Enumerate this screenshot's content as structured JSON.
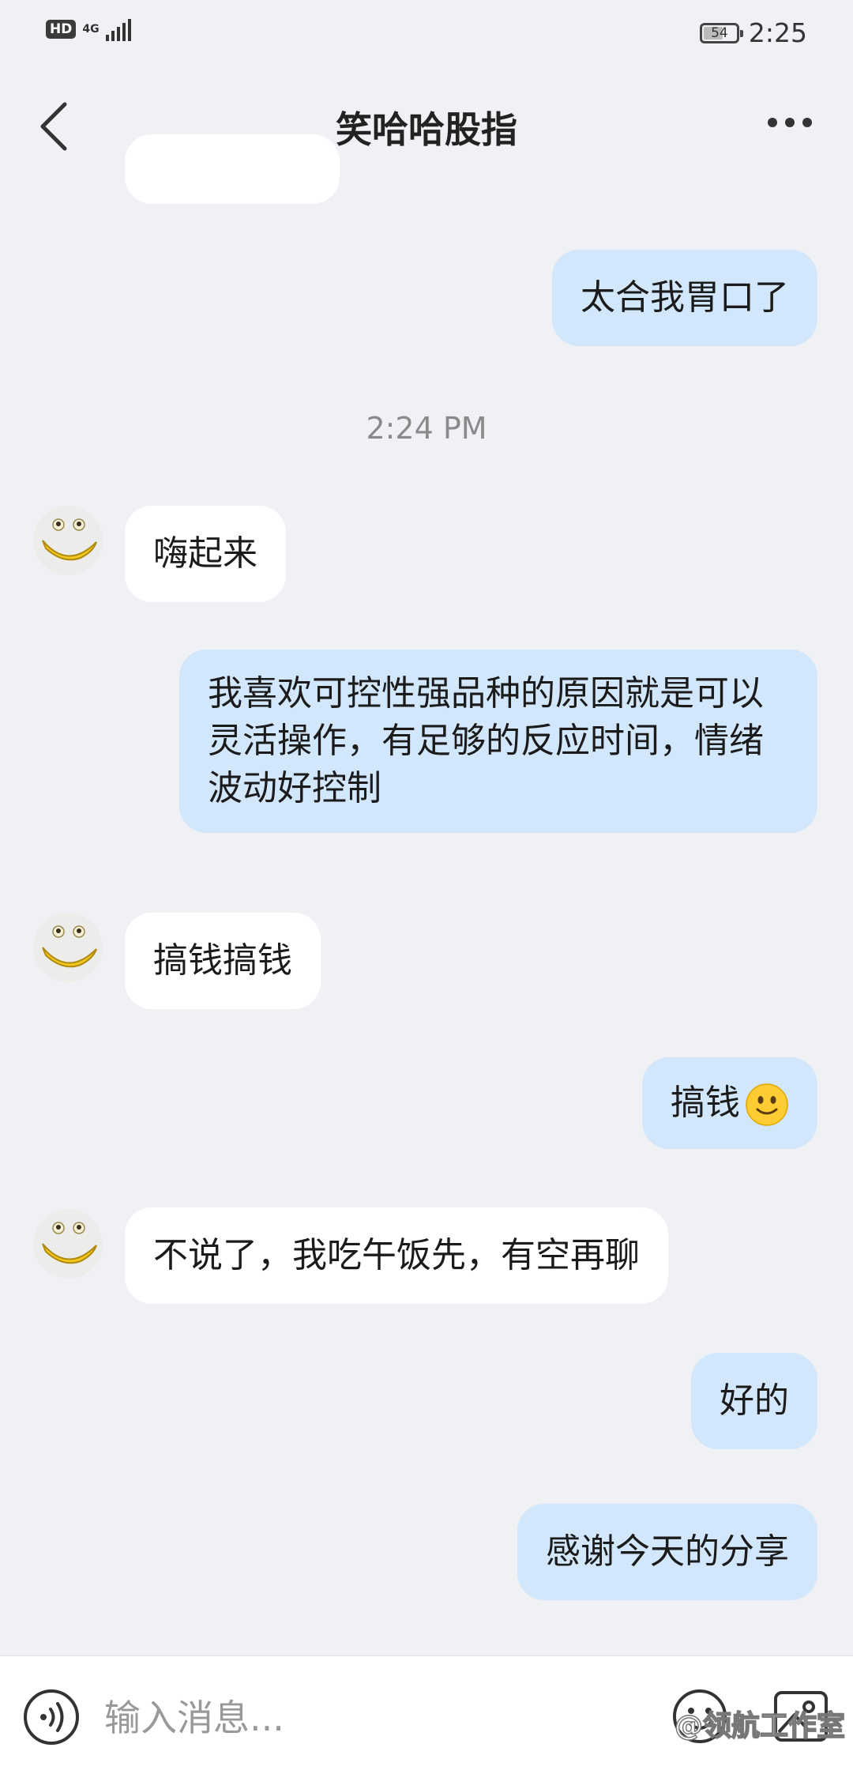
{
  "status_bar": {
    "hd_badge": "HD",
    "network_type": "4G",
    "battery_level": "54",
    "time": "2:25"
  },
  "header": {
    "title": "笑哈哈股指",
    "back_icon": "chevron-left-icon",
    "more_icon": "more-horizontal-icon"
  },
  "chat": {
    "timestamp": "2:24 PM",
    "messages": [
      {
        "from": "me",
        "text": "太合我胃口了"
      },
      {
        "from": "other",
        "text": "嗨起来"
      },
      {
        "from": "me",
        "text": "我喜欢可控性强品种的原因就是可以灵活操作，有足够的反应时间，情绪波动好控制"
      },
      {
        "from": "other",
        "text": "搞钱搞钱"
      },
      {
        "from": "me",
        "text": "搞钱",
        "emoji": "slightly-smiling-face"
      },
      {
        "from": "other",
        "text": "不说了，我吃午饭先，有空再聊"
      },
      {
        "from": "me",
        "text": "好的"
      },
      {
        "from": "me",
        "text": "感谢今天的分享"
      }
    ]
  },
  "input_bar": {
    "placeholder": "输入消息...",
    "voice_icon": "voice-icon",
    "emoji_icon": "emoji-icon",
    "image_icon": "image-icon"
  },
  "watermark": "@领航工作室",
  "colors": {
    "background": "#f0f1f5",
    "my_bubble": "#d2e7fc",
    "other_bubble": "#ffffff"
  }
}
